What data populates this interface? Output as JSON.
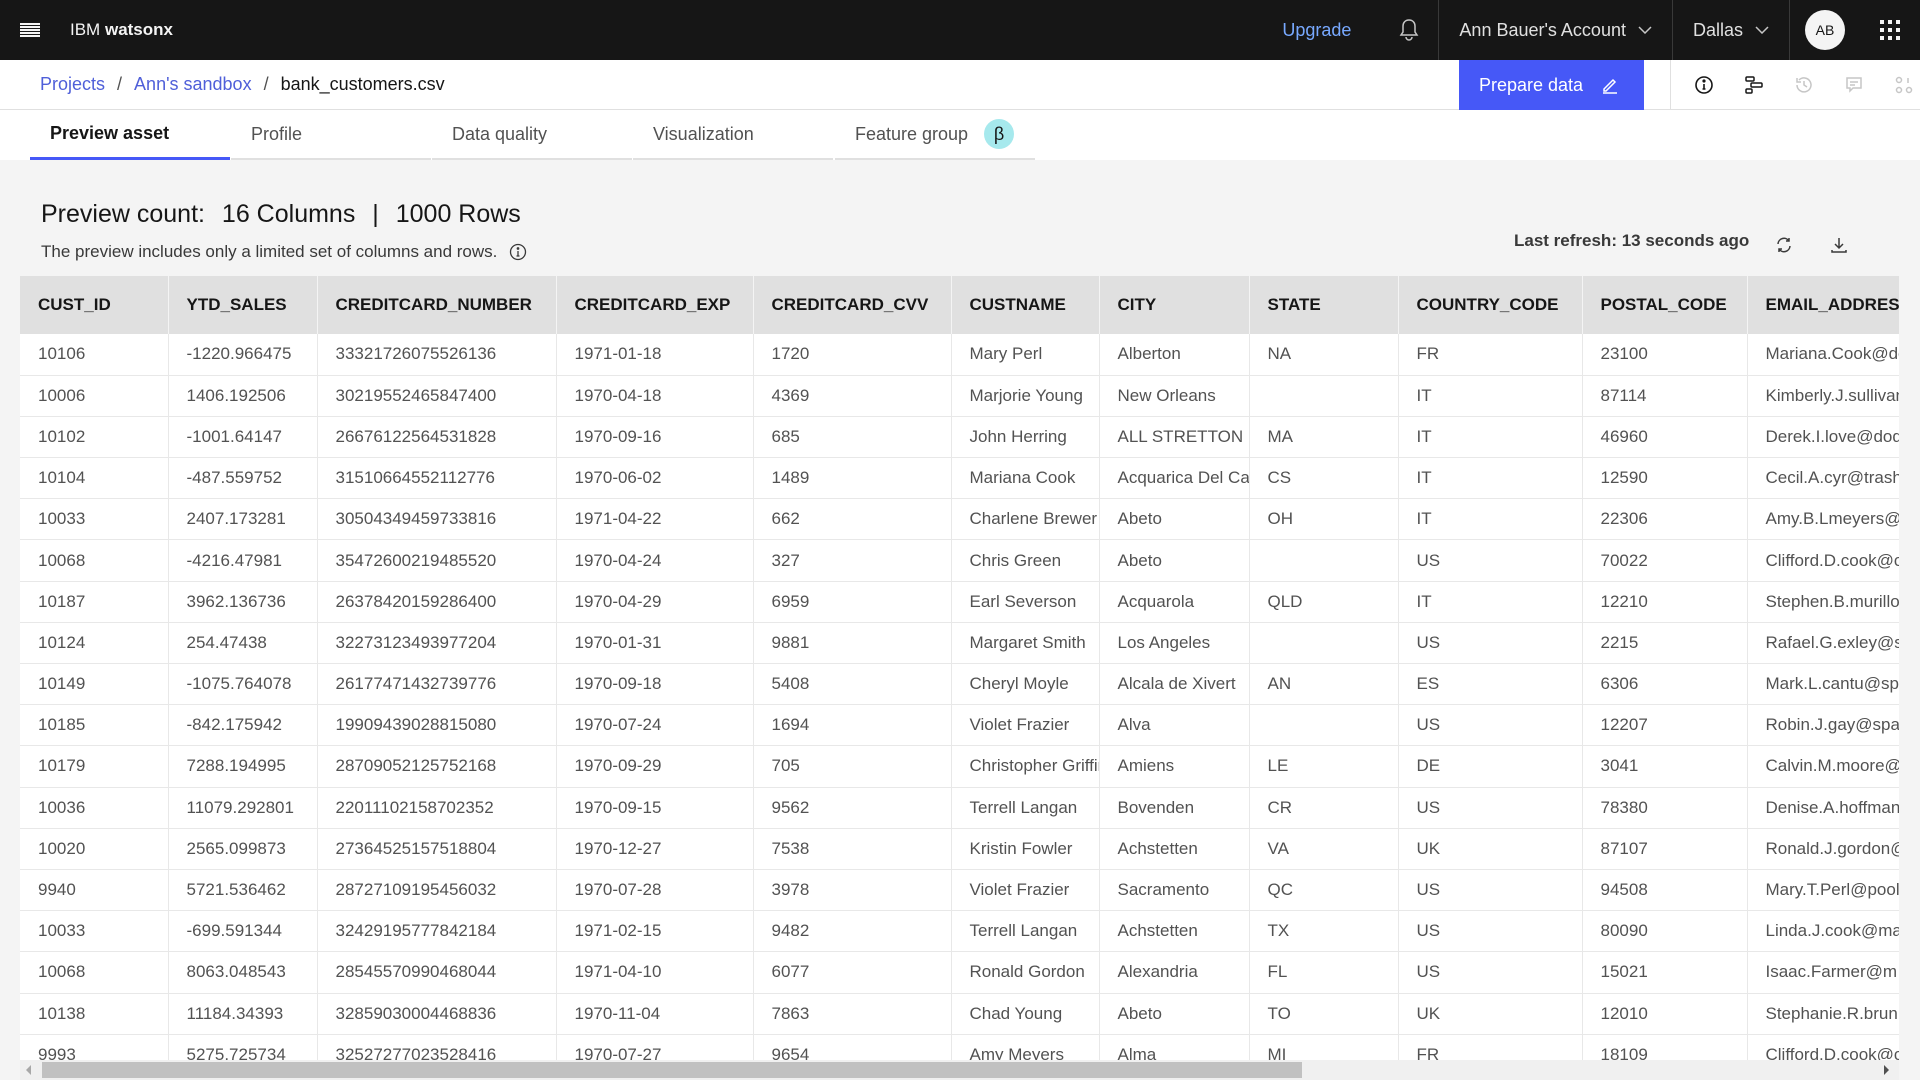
{
  "topbar": {
    "menu_icon": "hamburger-menu-icon",
    "brand_prefix": "IBM",
    "brand_name": "watsonx",
    "upgrade_label": "Upgrade",
    "notification_icon": "bell-icon",
    "account_label": "Ann Bauer's Account",
    "region_label": "Dallas",
    "avatar_initials": "AB",
    "switcher_icon": "app-switcher-icon"
  },
  "breadcrumb": {
    "items": [
      "Projects",
      "Ann's sandbox"
    ],
    "separator": "/",
    "current": "bank_customers.csv"
  },
  "actions": {
    "prepare_label": "Prepare data",
    "prepare_icon": "pencil-icon",
    "side_icons": [
      "info-icon",
      "lineage-icon",
      "history-icon",
      "comment-icon",
      "related-assets-icon"
    ]
  },
  "tabs": [
    {
      "label": "Preview asset",
      "active": true
    },
    {
      "label": "Profile",
      "active": false
    },
    {
      "label": "Data quality",
      "active": false
    },
    {
      "label": "Visualization",
      "active": false
    },
    {
      "label": "Feature group",
      "active": false,
      "badge": "β"
    }
  ],
  "preview": {
    "count_label": "Preview count:",
    "columns": "16 Columns",
    "divider": "|",
    "rows": "1000 Rows",
    "note": "The preview includes only a limited set of columns and rows.",
    "last_refresh": "Last refresh: 13 seconds ago"
  },
  "table": {
    "headers": [
      "CUST_ID",
      "YTD_SALES",
      "CREDITCARD_NUMBER",
      "CREDITCARD_EXP",
      "CREDITCARD_CVV",
      "CUSTNAME",
      "CITY",
      "STATE",
      "COUNTRY_CODE",
      "POSTAL_CODE",
      "EMAIL_ADDRESS"
    ],
    "rows": [
      [
        "10106",
        "-1220.966475",
        "33321726075526136",
        "1971-01-18",
        "1720",
        "Mary Perl",
        "Alberton",
        "NA",
        "FR",
        "23100",
        "Mariana.Cook@do"
      ],
      [
        "10006",
        "1406.192506",
        "30219552465847400",
        "1970-04-18",
        "4369",
        "Marjorie Young",
        "New Orleans",
        "",
        "IT",
        "87114",
        "Kimberly.J.sullivan"
      ],
      [
        "10102",
        "-1001.64147",
        "26676122564531828",
        "1970-09-16",
        "685",
        "John Herring",
        "ALL STRETTON",
        "MA",
        "IT",
        "46960",
        "Derek.I.love@dod"
      ],
      [
        "10104",
        "-487.559752",
        "31510664552112776",
        "1970-06-02",
        "1489",
        "Mariana Cook",
        "Acquarica Del Capo",
        "CS",
        "IT",
        "12590",
        "Cecil.A.cyr@trash"
      ],
      [
        "10033",
        "2407.173281",
        "30504349459733816",
        "1971-04-22",
        "662",
        "Charlene Brewer",
        "Abeto",
        "OH",
        "IT",
        "22306",
        "Amy.B.Lmeyers@"
      ],
      [
        "10068",
        "-4216.47981",
        "35472600219485520",
        "1970-04-24",
        "327",
        "Chris Green",
        "Abeto",
        "",
        "US",
        "70022",
        "Clifford.D.cook@c"
      ],
      [
        "10187",
        "3962.136736",
        "26378420159286400",
        "1970-04-29",
        "6959",
        "Earl Severson",
        "Acquarola",
        "QLD",
        "IT",
        "12210",
        "Stephen.B.murillo"
      ],
      [
        "10124",
        "254.47438",
        "32273123493977204",
        "1970-01-31",
        "9881",
        "Margaret Smith",
        "Los Angeles",
        "",
        "US",
        "2215",
        "Rafael.G.exley@s"
      ],
      [
        "10149",
        "-1075.764078",
        "26177471432739776",
        "1970-09-18",
        "5408",
        "Cheryl Moyle",
        "Alcala de Xivert",
        "AN",
        "ES",
        "6306",
        "Mark.L.cantu@sp"
      ],
      [
        "10185",
        "-842.175942",
        "19909439028815080",
        "1970-07-24",
        "1694",
        "Violet Frazier",
        "Alva",
        "",
        "US",
        "12207",
        "Robin.J.gay@spa"
      ],
      [
        "10179",
        "7288.194995",
        "28709052125752168",
        "1970-09-29",
        "705",
        "Christopher Griffin",
        "Amiens",
        "LE",
        "DE",
        "3041",
        "Calvin.M.moore@"
      ],
      [
        "10036",
        "11079.292801",
        "22011102158702352",
        "1970-09-15",
        "9562",
        "Terrell Langan",
        "Bovenden",
        "CR",
        "US",
        "78380",
        "Denise.A.hoffman"
      ],
      [
        "10020",
        "2565.099873",
        "27364525157518804",
        "1970-12-27",
        "7538",
        "Kristin Fowler",
        "Achstetten",
        "VA",
        "UK",
        "87107",
        "Ronald.J.gordon@"
      ],
      [
        "9940",
        "5721.536462",
        "28727109195456032",
        "1970-07-28",
        "3978",
        "Violet Frazier",
        "Sacramento",
        "QC",
        "US",
        "94508",
        "Mary.T.Perl@pool"
      ],
      [
        "10033",
        "-699.591344",
        "32429195777842184",
        "1971-02-15",
        "9482",
        "Terrell Langan",
        "Achstetten",
        "TX",
        "US",
        "80090",
        "Linda.J.cook@ma"
      ],
      [
        "10068",
        "8063.048543",
        "28545570990468044",
        "1971-04-10",
        "6077",
        "Ronald Gordon",
        "Alexandria",
        "FL",
        "US",
        "15021",
        "Isaac.Farmer@m"
      ],
      [
        "10138",
        "11184.34393",
        "32859030004468836",
        "1970-11-04",
        "7863",
        "Chad Young",
        "Abeto",
        "TO",
        "UK",
        "12010",
        "Stephanie.R.brun"
      ],
      [
        "9993",
        "5275.725734",
        "32527277023528416",
        "1970-07-27",
        "9654",
        "Amy Meyers",
        "Alma",
        "MI",
        "FR",
        "18109",
        "Clifford.D.cook@c"
      ]
    ]
  },
  "colors": {
    "topbar_bg": "#161616",
    "accent": "#4658f7",
    "link": "#4f5fd9",
    "upgrade": "#78a9ff",
    "beta_badge": "#a6e9ed"
  }
}
